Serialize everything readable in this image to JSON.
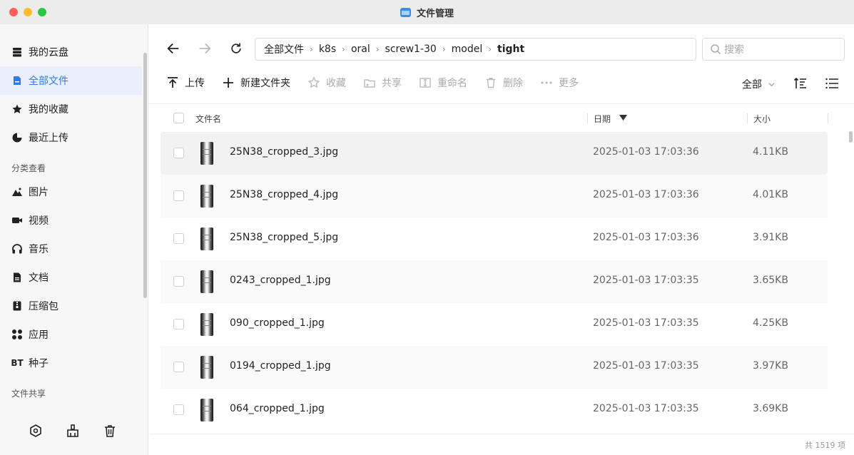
{
  "window": {
    "title": "文件管理"
  },
  "sidebar": {
    "items": [
      {
        "label": "我的云盘",
        "icon": "drive-icon"
      },
      {
        "label": "全部文件",
        "icon": "file-icon"
      },
      {
        "label": "我的收藏",
        "icon": "star-icon"
      },
      {
        "label": "最近上传",
        "icon": "clock-icon"
      }
    ],
    "category_title": "分类查看",
    "categories": [
      {
        "label": "图片",
        "icon": "image-icon"
      },
      {
        "label": "视频",
        "icon": "video-icon"
      },
      {
        "label": "音乐",
        "icon": "headphones-icon"
      },
      {
        "label": "文档",
        "icon": "document-icon"
      },
      {
        "label": "压缩包",
        "icon": "archive-icon"
      },
      {
        "label": "应用",
        "icon": "apps-icon"
      },
      {
        "label": "种子",
        "icon": "bt-icon",
        "badge": "BT"
      }
    ],
    "share_title": "文件共享"
  },
  "breadcrumb": [
    "全部文件",
    "k8s",
    "oral",
    "screw1-30",
    "model",
    "tight"
  ],
  "search": {
    "placeholder": "搜索"
  },
  "toolbar": {
    "upload": "上传",
    "new_folder": "新建文件夹",
    "favorite": "收藏",
    "share": "共享",
    "rename": "重命名",
    "delete": "删除",
    "more": "更多",
    "filter": "全部"
  },
  "table": {
    "headers": {
      "name": "文件名",
      "date": "日期",
      "size": "大小"
    },
    "rows": [
      {
        "name": "25N38_cropped_3.jpg",
        "date": "2025-01-03 17:03:36",
        "size": "4.11KB"
      },
      {
        "name": "25N38_cropped_4.jpg",
        "date": "2025-01-03 17:03:36",
        "size": "4.01KB"
      },
      {
        "name": "25N38_cropped_5.jpg",
        "date": "2025-01-03 17:03:36",
        "size": "3.91KB"
      },
      {
        "name": "0243_cropped_1.jpg",
        "date": "2025-01-03 17:03:35",
        "size": "3.65KB"
      },
      {
        "name": "090_cropped_1.jpg",
        "date": "2025-01-03 17:03:35",
        "size": "4.25KB"
      },
      {
        "name": "0194_cropped_1.jpg",
        "date": "2025-01-03 17:03:35",
        "size": "3.97KB"
      },
      {
        "name": "064_cropped_1.jpg",
        "date": "2025-01-03 17:03:35",
        "size": "3.69KB"
      }
    ]
  },
  "footer": {
    "count": "共 1519 项"
  },
  "colors": {
    "accent": "#2f7ae5",
    "close": "#ff5f57",
    "minimize": "#febc2e",
    "zoom": "#28c840"
  }
}
